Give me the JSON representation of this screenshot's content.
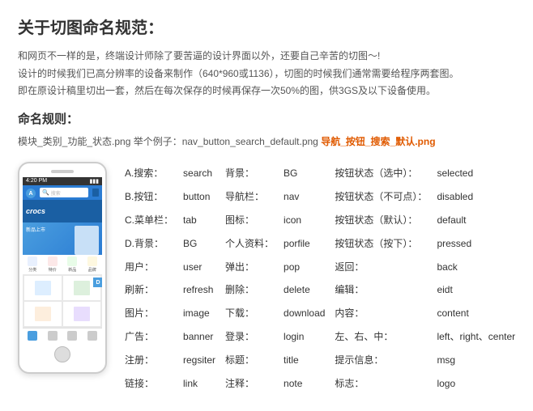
{
  "page": {
    "title": "关于切图命名规范：",
    "intro_lines": [
      "和网页不一样的是，终端设计师除了要苦逼的设计界面以外，还要自己辛苦的切图～!",
      "设计的时候我们已高分辨率的设备来制作（640*960或1136），切图的时候我们通常需要给程序两套图。",
      "即在原设计稿里切出一套，然后在每次保存的时候再保存一次50%的图，供3GS及以下设备使用。"
    ],
    "rule_title": "命名规则：",
    "rule_example_prefix": "模块_类别_功能_状态.png    举个例子：nav_button_search_default.png    ",
    "rule_example_highlight": "导航_按钮_搜索_默认.png",
    "phone": {
      "time": "4:20 PM",
      "search_placeholder": "搜索",
      "logo": "crocs",
      "labels": [
        "A",
        "D"
      ]
    },
    "terms": [
      {
        "rows": [
          {
            "label": "A.搜索：",
            "value": "search"
          },
          {
            "label": "B.按钮：",
            "value": "button"
          },
          {
            "label": "C.菜单栏：",
            "value": "tab"
          },
          {
            "label": "D.背景：",
            "value": "BG"
          },
          {
            "label": "用户：",
            "value": "user"
          },
          {
            "label": "刷新：",
            "value": "refresh"
          },
          {
            "label": "图片：",
            "value": "image"
          },
          {
            "label": "广告：",
            "value": "banner"
          },
          {
            "label": "注册：",
            "value": "regsiter"
          },
          {
            "label": "链接：",
            "value": "link"
          }
        ]
      },
      {
        "rows": [
          {
            "label": "背景：",
            "value": "BG"
          },
          {
            "label": "导航栏：",
            "value": "nav"
          },
          {
            "label": "图标：",
            "value": "icon"
          },
          {
            "label": "个人资料：",
            "value": "porfile"
          },
          {
            "label": "弹出：",
            "value": "pop"
          },
          {
            "label": "删除：",
            "value": "delete"
          },
          {
            "label": "下载：",
            "value": "download"
          },
          {
            "label": "登录：",
            "value": "login"
          },
          {
            "label": "标题：",
            "value": "title"
          },
          {
            "label": "注释：",
            "value": "note"
          }
        ]
      },
      {
        "rows": [
          {
            "label": "按钮状态（选中）：",
            "value": "selected"
          },
          {
            "label": "按钮状态（不可点）：",
            "value": "disabled"
          },
          {
            "label": "按钮状态（默认）：",
            "value": "default"
          },
          {
            "label": "按钮状态（按下）：",
            "value": "pressed"
          },
          {
            "label": "返回：",
            "value": "back"
          },
          {
            "label": "编辑：",
            "value": "eidt"
          },
          {
            "label": "内容：",
            "value": "content"
          },
          {
            "label": "左、右、中：",
            "value": "left、right、center"
          },
          {
            "label": "提示信息：",
            "value": "msg"
          },
          {
            "label": "标志：",
            "value": "logo"
          }
        ]
      }
    ]
  }
}
